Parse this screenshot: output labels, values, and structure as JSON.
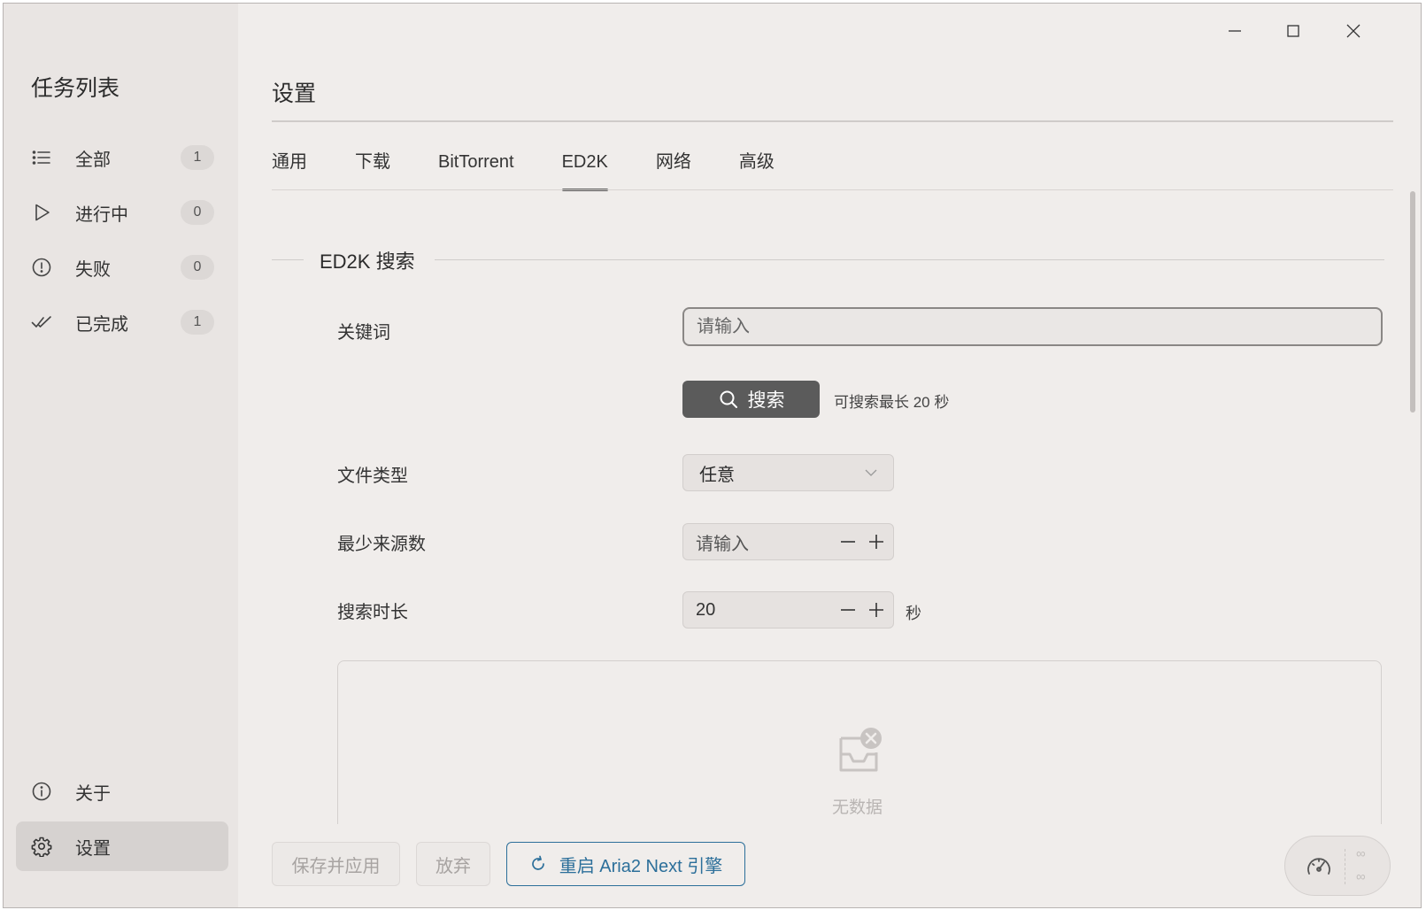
{
  "sidebar": {
    "title": "任务列表",
    "items": [
      {
        "label": "全部",
        "count": "1",
        "icon": "list-icon"
      },
      {
        "label": "进行中",
        "count": "0",
        "icon": "play-icon"
      },
      {
        "label": "失败",
        "count": "0",
        "icon": "alert-circle-icon"
      },
      {
        "label": "已完成",
        "count": "1",
        "icon": "double-check-icon"
      }
    ],
    "about": "关于",
    "settings": "设置"
  },
  "main": {
    "title": "设置",
    "tabs": [
      "通用",
      "下载",
      "BitTorrent",
      "ED2K",
      "网络",
      "高级"
    ],
    "active_tab": "ED2K",
    "section_title": "ED2K 搜索",
    "keyword": {
      "label": "关键词",
      "placeholder": "请输入",
      "value": ""
    },
    "search_button": "搜索",
    "search_hint": "可搜索最长 20 秒",
    "file_type": {
      "label": "文件类型",
      "value": "任意"
    },
    "min_sources": {
      "label": "最少来源数",
      "placeholder": "请输入"
    },
    "search_duration": {
      "label": "搜索时长",
      "value": "20",
      "unit": "秒"
    },
    "empty_text": "无数据"
  },
  "footer": {
    "save": "保存并应用",
    "discard": "放弃",
    "restart": "重启 Aria2 Next 引擎"
  },
  "speed": {
    "upload": "∞",
    "download": "∞"
  },
  "colors": {
    "accent": "#2c6f9a",
    "primary_button": "#5b5b5b",
    "sidebar_bg": "#e9e5e3",
    "main_bg": "#f0edeb"
  }
}
